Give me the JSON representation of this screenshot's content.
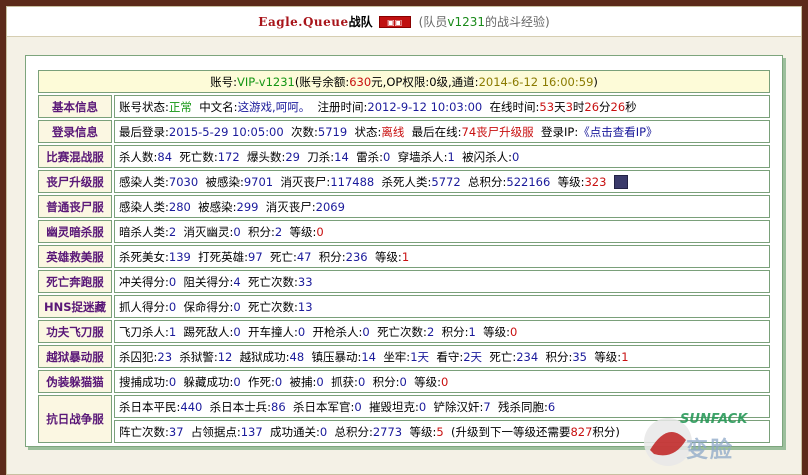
{
  "title": {
    "team_name": "Eagle.Queue",
    "team_suffix": "战队",
    "sub_prefix": "(队员",
    "sub_member": "v1231",
    "sub_suffix": "的战斗经验)"
  },
  "account": {
    "label": "账号:",
    "id": "VIP-v1231",
    "balance_label": "(账号余额:",
    "balance": "630",
    "balance_unit": "元",
    "op_label": ",OP权限:",
    "op_value": "0级",
    "channel_label": ",通道:",
    "channel_value": "2014-6-12 16:00:59",
    "end": ")"
  },
  "rows": {
    "basic": {
      "cat": "基本信息",
      "status_label": "账号状态:",
      "status": "正常",
      "cn_label": "中文名:",
      "cn_name": "这游戏,呵呵。",
      "reg_label": "注册时间:",
      "reg_time": "2012-9-12 10:03:00",
      "online_label": "在线时间:",
      "days": "53",
      "days_u": "天",
      "hours": "3",
      "hours_u": "时",
      "mins": "26",
      "mins_u": "分",
      "secs": "26",
      "secs_u": "秒"
    },
    "login": {
      "cat": "登录信息",
      "last_label": "最后登录:",
      "last": "2015-5-29 10:05:00",
      "count_label": "次数:",
      "count": "5719",
      "state_label": "状态:",
      "state": "离线",
      "last_online_label": "最后在线:",
      "last_online": "74丧尸升级服",
      "ip_label": "登录IP:",
      "ip_link": "《点击查看IP》"
    },
    "match": {
      "cat": "比赛混战服",
      "kills_label": "杀人数:",
      "kills": "84",
      "deaths_label": "死亡数:",
      "deaths": "172",
      "hs_label": "爆头数:",
      "hs": "29",
      "knife_label": "刀杀:",
      "knife": "14",
      "nade_label": "雷杀:",
      "nade": "0",
      "wall_label": "穿墙杀人:",
      "wall": "1",
      "flash_label": "被闪杀人:",
      "flash": "0"
    },
    "zombie_up": {
      "cat": "丧尸升级服",
      "inf_label": "感染人类:",
      "inf": "7030",
      "infd_label": "被感染:",
      "infd": "9701",
      "kz_label": "消灭丧尸:",
      "kz": "117488",
      "kh_label": "杀死人类:",
      "kh": "5772",
      "pts_label": "总积分:",
      "pts": "522166",
      "lvl_label": "等级:",
      "lvl": "323"
    },
    "zombie_normal": {
      "cat": "普通丧尸服",
      "inf_label": "感染人类:",
      "inf": "280",
      "infd_label": "被感染:",
      "infd": "299",
      "kz_label": "消灭丧尸:",
      "kz": "2069"
    },
    "ghost": {
      "cat": "幽灵暗杀服",
      "kh_label": "暗杀人类:",
      "kh": "2",
      "kg_label": "消灭幽灵:",
      "kg": "0",
      "pts_label": "积分:",
      "pts": "2",
      "lvl_label": "等级:",
      "lvl": "0"
    },
    "hero": {
      "cat": "英雄救美服",
      "kb_label": "杀死美女:",
      "kb": "139",
      "kh_label": "打死英雄:",
      "kh": "97",
      "d_label": "死亡:",
      "d": "47",
      "pts_label": "积分:",
      "pts": "236",
      "lvl_label": "等级:",
      "lvl": "1"
    },
    "death_run": {
      "cat": "死亡奔跑服",
      "rush_label": "冲关得分:",
      "rush": "0",
      "block_label": "阻关得分:",
      "block": "4",
      "d_label": "死亡次数:",
      "d": "33"
    },
    "hns": {
      "cat": "HNS捉迷藏",
      "catch_label": "抓人得分:",
      "catch": "0",
      "save_label": "保命得分:",
      "save": "0",
      "d_label": "死亡次数:",
      "d": "13"
    },
    "kungfu": {
      "cat": "功夫飞刀服",
      "fk_label": "飞刀杀人:",
      "fk": "1",
      "kick_label": "踢死敌人:",
      "kick": "0",
      "car_label": "开车撞人:",
      "car": "0",
      "gun_label": "开枪杀人:",
      "gun": "0",
      "d_label": "死亡次数:",
      "d": "2",
      "pts_label": "积分:",
      "pts": "1",
      "lvl_label": "等级:",
      "lvl": "0"
    },
    "jail": {
      "cat": "越狱暴动服",
      "kp_label": "杀囚犯:",
      "kp": "23",
      "kg_label": "杀狱警:",
      "kg": "12",
      "esc_label": "越狱成功:",
      "esc": "48",
      "riot_label": "镇压暴动:",
      "riot": "14",
      "sit_label": "坐牢:",
      "sit": "1天",
      "guard_label": "看守:",
      "guard": "2天",
      "d_label": "死亡:",
      "d": "234",
      "pts_label": "积分:",
      "pts": "35",
      "lvl_label": "等级:",
      "lvl": "1"
    },
    "disguise": {
      "cat": "伪装躲猫猫",
      "s_label": "搜捕成功:",
      "s": "0",
      "h_label": "躲藏成功:",
      "h": "0",
      "c_label": "作死:",
      "c": "0",
      "ca_label": "被捕:",
      "ca": "0",
      "g_label": "抓获:",
      "g": "0",
      "pts_label": "积分:",
      "pts": "0",
      "lvl_label": "等级:",
      "lvl": "0"
    },
    "war": {
      "cat": "抗日战争服",
      "civ_label": "杀日本平民:",
      "civ": "440",
      "sol_label": "杀日本士兵:",
      "sol": "86",
      "off_label": "杀日本军官:",
      "off": "0",
      "tank_label": "摧毁坦克:",
      "tank": "0",
      "trait_label": "铲除汉奸:",
      "trait": "7",
      "comp_label": "残杀同胞:",
      "comp": "6",
      "camp_label": "阵亡次数:",
      "camp": "37",
      "occ_label": "占领据点:",
      "occ": "137",
      "pass_label": "成功通关:",
      "pass": "0",
      "pts_label": "总积分:",
      "pts": "2773",
      "lvl_label": "等级:",
      "lvl": "5",
      "next_prefix": "(升级到下一等级还需要",
      "next": "827",
      "next_suffix": "积分)"
    }
  },
  "watermark": {
    "text": "SUNFACK",
    "big": "变脸"
  },
  "colors": {
    "background": "#5c2a1a",
    "category": "#5a1878",
    "number": "#1a1a9a",
    "highlight": "#c81010",
    "ok": "#149614"
  }
}
